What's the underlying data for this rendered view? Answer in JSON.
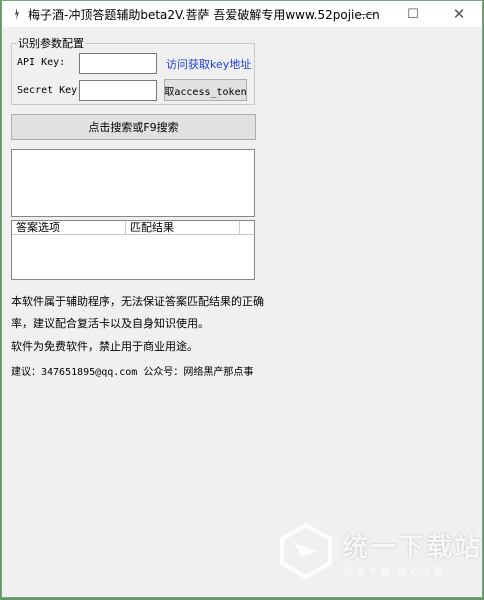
{
  "window": {
    "title": "梅子酒-冲顶答题辅助beta2V.菩萨    吾爱破解专用www.52pojie.cn",
    "minimize": "—",
    "maximize": "☐",
    "close": "✕"
  },
  "config": {
    "legend": "识别参数配置",
    "api_key_label": "API Key:",
    "api_key_value": "",
    "secret_key_label": "Secret Key:",
    "secret_key_value": "",
    "get_key_link": "访问获取key地址",
    "token_button": "取access_token"
  },
  "search_button": "点击搜索或F9搜索",
  "result_list": {
    "columns": [
      "答案选项",
      "匹配结果"
    ]
  },
  "info": {
    "disclaimer_line1": "本软件属于辅助程序，无法保证答案匹配结果的正确",
    "disclaimer_line2": "率，建议配合复活卡以及自身知识使用。",
    "free_notice": "软件为免费软件，禁止用于商业用途。",
    "contact": "建议：347651895@qq.com 公众号：网络黑产那点事"
  },
  "watermark": {
    "text": "统一下载站",
    "sub": "绿色下载  放心下载"
  }
}
